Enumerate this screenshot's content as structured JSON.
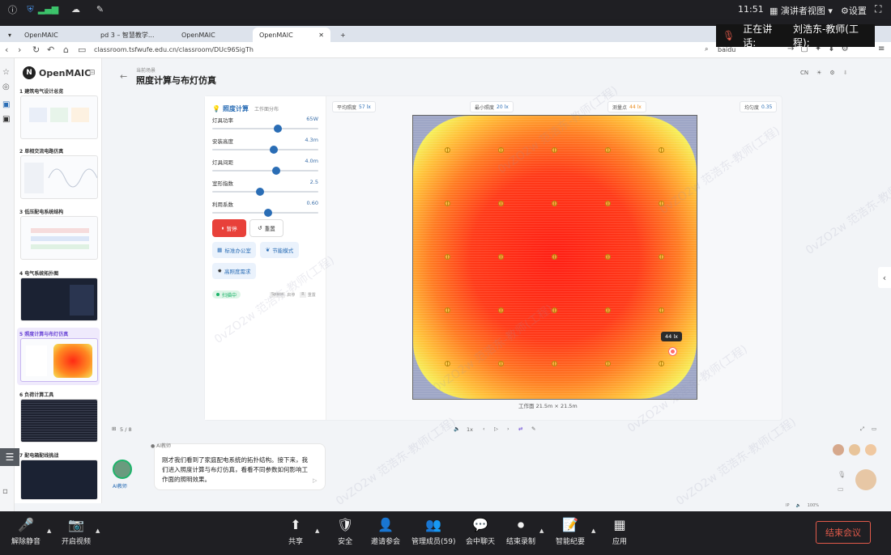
{
  "os": {
    "time": "11:51",
    "presenter_view": "演讲者视图",
    "settings": "设置"
  },
  "speaking": {
    "label": "正在讲话:",
    "name": "刘浩东-教师(工程);"
  },
  "tabs": [
    {
      "label": "OpenMAIC"
    },
    {
      "label": "pd 3 – 智慧教学..."
    },
    {
      "label": "OpenMAIC"
    },
    {
      "label": "OpenMAIC"
    }
  ],
  "address": {
    "url": "classroom.tsfwufe.edu.cn/classroom/DUc96SigTh",
    "search": "baidu"
  },
  "sidebar": {
    "brand": "OpenMAIC",
    "slides": [
      {
        "title": "1  建筑电气设计总览"
      },
      {
        "title": "2  单相交流电路仿真"
      },
      {
        "title": "3  低压配电系统结构"
      },
      {
        "title": "4  电气系统拓扑图"
      },
      {
        "title": "5  照度计算与布灯仿真"
      },
      {
        "title": "6  负荷计算工具"
      },
      {
        "title": "7  配电箱配线挑战"
      }
    ]
  },
  "scene": {
    "crumb": "当前场景",
    "title": "照度计算与布灯仿真",
    "lang": "CN"
  },
  "panel": {
    "title": "照度计算",
    "subtitle": "工作面分布",
    "sliders": [
      {
        "label": "灯具功率",
        "value": "65W",
        "level": 0.62
      },
      {
        "label": "安装高度",
        "value": "4.3m",
        "level": 0.58
      },
      {
        "label": "灯具间距",
        "value": "4.0m",
        "level": 0.6
      },
      {
        "label": "室形指数",
        "value": "2.5",
        "level": 0.45
      },
      {
        "label": "利用系数",
        "value": "0.60",
        "level": 0.53
      }
    ],
    "pause": "暂停",
    "reset": "重置",
    "presets": [
      "标准办公室",
      "节能模式",
      "高照度需求"
    ],
    "status": "扫描中",
    "hint_key1": "Space",
    "hint_txt1": "启停",
    "hint_key2": "R",
    "hint_txt2": "重置"
  },
  "stats": [
    {
      "label": "平均照度",
      "value": "57 lx"
    },
    {
      "label": "最小照度",
      "value": "20 lx"
    },
    {
      "label": "测量点",
      "value": "44 lx"
    },
    {
      "label": "均匀度",
      "value": "0.35"
    }
  ],
  "heatmap": {
    "tooltip": "44 lx",
    "dims": "工作面 21.5m × 21.5m"
  },
  "player": {
    "page": "5 / 8",
    "speed": "1x"
  },
  "teacher": {
    "name": "AI教师",
    "message": "刚才我们看到了家庭配电系统的拓扑结构。接下来，我们进入照度计算与布灯仿真，看看不同参数如何影响工作面的照明效果。"
  },
  "meeting": {
    "buttons": [
      {
        "label": "解除静音",
        "icon": "🎤"
      },
      {
        "label": "开启视频",
        "icon": "📷"
      },
      {
        "label": "共享",
        "icon": "⬆"
      },
      {
        "label": "安全",
        "icon": "🛡"
      },
      {
        "label": "邀请参会",
        "icon": "👤"
      },
      {
        "label": "管理成员(59)",
        "icon": "👥"
      },
      {
        "label": "会中聊天",
        "icon": "💬"
      },
      {
        "label": "结束录制",
        "icon": "⏺"
      },
      {
        "label": "智能纪要",
        "icon": "📝"
      },
      {
        "label": "应用",
        "icon": "▦"
      }
    ],
    "end": "结束会议"
  },
  "watermark": "0vZO2w 范浩东-教师(工程)",
  "colors": {
    "accent": "#2a6db5",
    "pause": "#e8413a",
    "status": "#1db36a"
  }
}
